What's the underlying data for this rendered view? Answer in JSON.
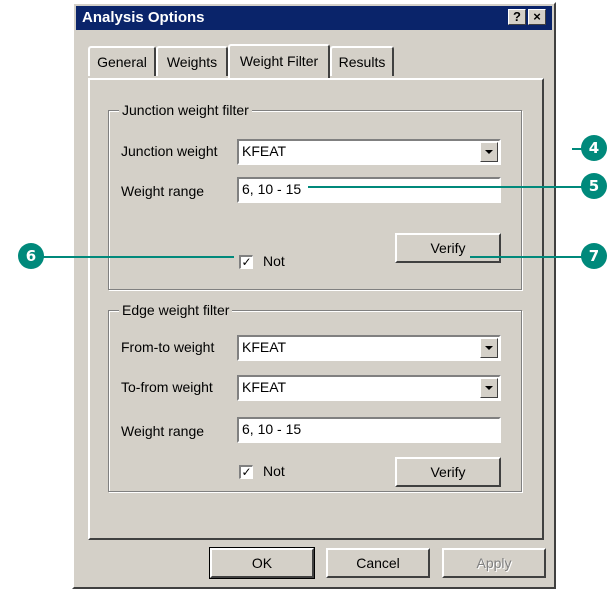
{
  "window": {
    "title": "Analysis Options",
    "help_label": "?",
    "close_label": "×"
  },
  "tabs": [
    {
      "label": "General",
      "active": false
    },
    {
      "label": "Weights",
      "active": false
    },
    {
      "label": "Weight Filter",
      "active": true
    },
    {
      "label": "Results",
      "active": false
    }
  ],
  "junction_filter": {
    "group_title": "Junction weight filter",
    "weight_label": "Junction weight",
    "weight_value": "KFEAT",
    "range_label": "Weight range",
    "range_value": "6, 10 - 15",
    "not_label": "Not",
    "not_checked": true,
    "verify_label": "Verify"
  },
  "edge_filter": {
    "group_title": "Edge weight filter",
    "from_to_label": "From-to weight",
    "from_to_value": "KFEAT",
    "to_from_label": "To-from weight",
    "to_from_value": "KFEAT",
    "range_label": "Weight range",
    "range_value": "6, 10 - 15",
    "not_label": "Not",
    "not_checked": true,
    "verify_label": "Verify"
  },
  "footer": {
    "ok_label": "OK",
    "cancel_label": "Cancel",
    "apply_label": "Apply",
    "apply_enabled": false
  },
  "callouts": [
    "4",
    "5",
    "6",
    "7"
  ],
  "colors": {
    "callout": "#00897b",
    "titlebar": "#0a246a",
    "dialog_face": "#d4d0c8"
  },
  "icons": {
    "check": "✓",
    "dropdown": "chevron-down-icon"
  }
}
